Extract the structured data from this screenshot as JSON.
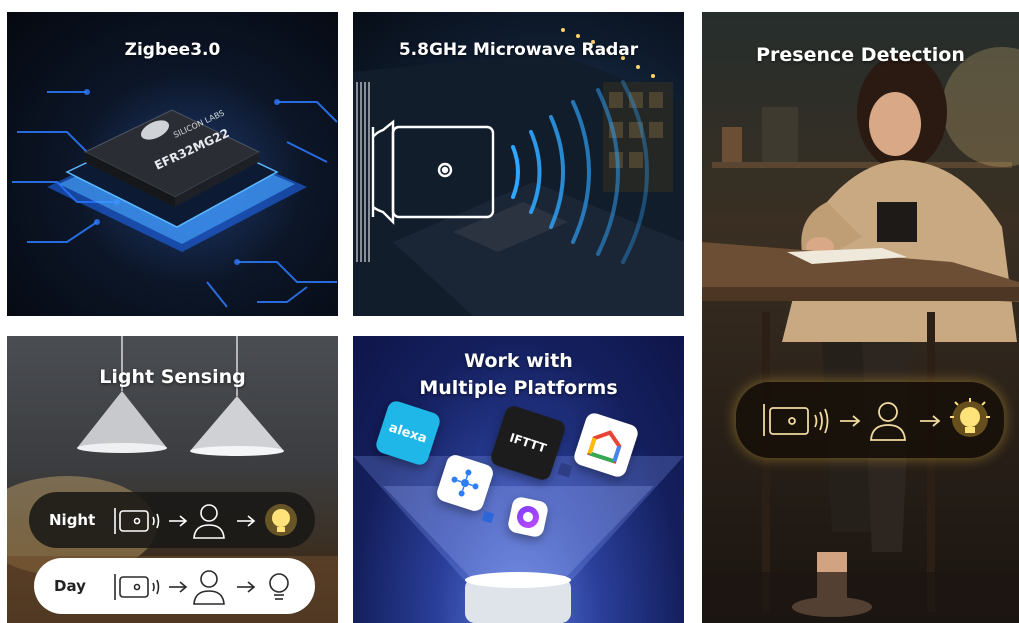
{
  "tiles": {
    "zigbee": {
      "title": "Zigbee3.0",
      "chip_brand": "SILICON LABS",
      "chip_model": "EFR32MG22"
    },
    "radar": {
      "title": "5.8GHz Microwave Radar"
    },
    "presence": {
      "title": "Presence Detection"
    },
    "light": {
      "title": "Light Sensing",
      "night_label": "Night",
      "day_label": "Day"
    },
    "platforms": {
      "title_line1": "Work with",
      "title_line2": "Multiple Platforms",
      "alexa_label": "alexa",
      "ifttt_label": "IFTTT"
    }
  },
  "icons": {
    "device": "sensor-device-icon",
    "waves": "radar-wave-icon",
    "arrow": "arrow-right-icon",
    "person": "person-icon",
    "bulb": "light-bulb-icon"
  },
  "colors": {
    "glow_gold": "#f5c443",
    "chip_blue": "#2a8cff",
    "platform_blue": "#2a3f9a"
  }
}
